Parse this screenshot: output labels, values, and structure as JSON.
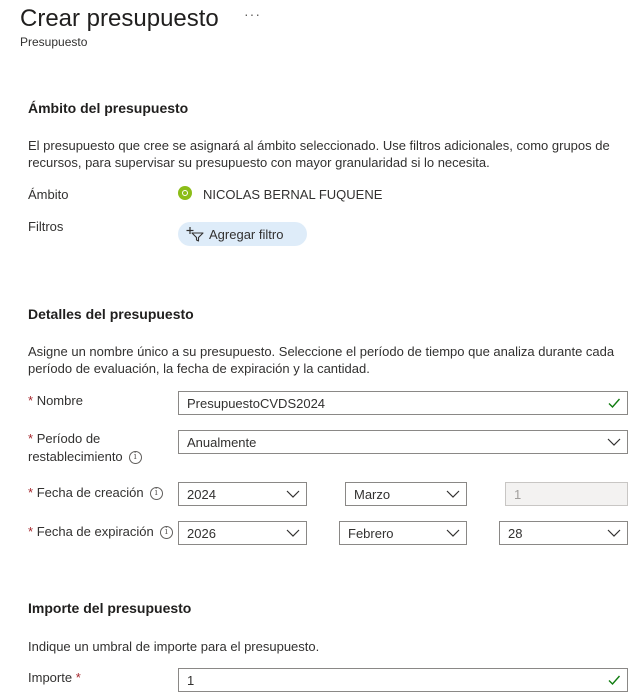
{
  "header": {
    "title": "Crear presupuesto",
    "more_label": "···",
    "subtitle": "Presupuesto"
  },
  "scope_section": {
    "heading": "Ámbito del presupuesto",
    "description": "El presupuesto que cree se asignará al ámbito seleccionado. Use filtros adicionales, como grupos de recursos, para supervisar su presupuesto con mayor granularidad si lo necesita.",
    "scope_label": "Ámbito",
    "scope_value": "NICOLAS BERNAL FUQUENE",
    "filters_label": "Filtros",
    "add_filter_label": "Agregar filtro"
  },
  "details_section": {
    "heading": "Detalles del presupuesto",
    "description": "Asigne un nombre único a su presupuesto. Seleccione el período de tiempo que analiza durante cada período de evaluación, la fecha de expiración y la cantidad.",
    "required_mark": "*",
    "name_label": "Nombre",
    "name_value": "PresupuestoCVDS2024",
    "reset_label_line1": "Período de",
    "reset_label_line2": "restablecimiento",
    "reset_value": "Anualmente",
    "creation_label": "Fecha de creación",
    "creation_year": "2024",
    "creation_month": "Marzo",
    "creation_day": "1",
    "expiration_label": "Fecha de expiración",
    "expiration_year": "2026",
    "expiration_month": "Febrero",
    "expiration_day": "28",
    "info_glyph": "i"
  },
  "amount_section": {
    "heading": "Importe del presupuesto",
    "description": "Indique un umbral de importe para el presupuesto.",
    "amount_label": "Importe",
    "required_mark": "*",
    "amount_value": "1"
  },
  "colors": {
    "accent": "#0078d4",
    "valid_check": "#107c10",
    "required": "#a4262c",
    "filter_pill_bg": "#deecf9",
    "scope_icon": "#8cbd18"
  }
}
